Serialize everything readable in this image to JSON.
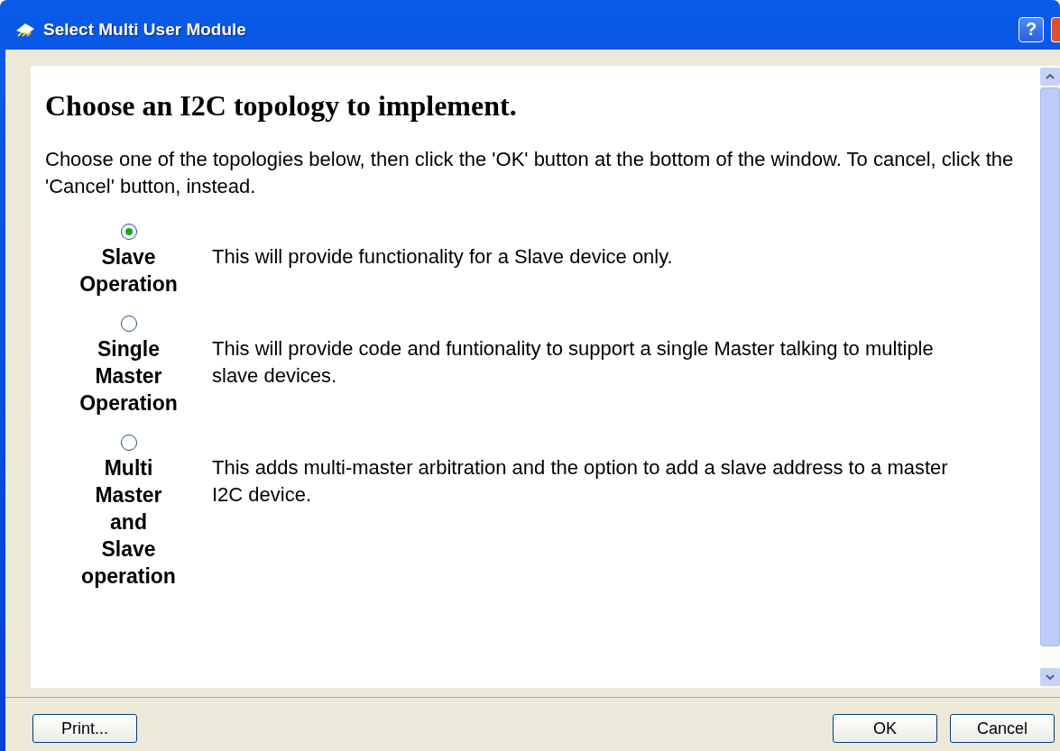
{
  "window": {
    "title": "Select Multi User Module",
    "help": "?"
  },
  "heading": "Choose an I2C topology to implement.",
  "intro": "Choose one of the topologies below, then click the 'OK' button at the bottom of the window. To cancel, click the 'Cancel' button, instead.",
  "options": [
    {
      "label": "Slave Operation",
      "description": "This will provide functionality for a Slave device only.",
      "selected": true
    },
    {
      "label": "Single Master Operation",
      "description": "This will provide code and funtionality to support a single Master talking to multiple slave devices.",
      "selected": false
    },
    {
      "label": "Multi Master and Slave operation",
      "description": "This adds multi-master arbitration and the option to add a slave address to a master I2C device.",
      "selected": false
    }
  ],
  "buttons": {
    "left": "Print...",
    "ok": "OK",
    "cancel": "Cancel"
  }
}
